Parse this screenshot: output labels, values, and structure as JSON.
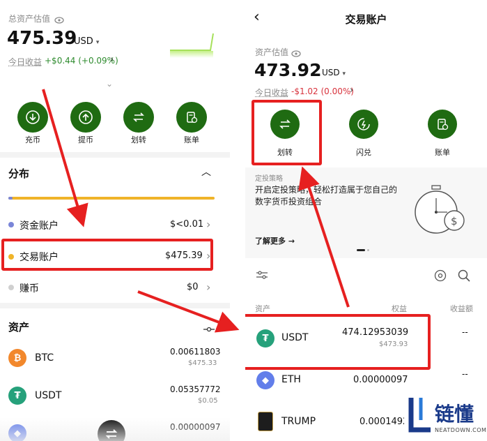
{
  "left": {
    "total_label": "总资产估值",
    "total_value": "475.39",
    "currency": "USD",
    "today_label": "今日收益",
    "today_value": "+$0.44 (+0.09%)",
    "actions": [
      {
        "label": "充币",
        "icon": "deposit-icon"
      },
      {
        "label": "提币",
        "icon": "withdraw-icon"
      },
      {
        "label": "划转",
        "icon": "transfer-icon"
      },
      {
        "label": "账单",
        "icon": "bill-icon"
      }
    ],
    "distribution_title": "分布",
    "accounts": [
      {
        "name": "资金账户",
        "value": "$<0.01",
        "color": "#7a86d8"
      },
      {
        "name": "交易账户",
        "value": "$475.39",
        "color": "#f0b429"
      },
      {
        "name": "赚币",
        "value": "$0",
        "color": "#d0d0d0"
      }
    ],
    "assets_title": "资产",
    "assets": [
      {
        "symbol": "BTC",
        "amount": "0.00611803",
        "usd": "$475.33",
        "color": "#f2882c"
      },
      {
        "symbol": "USDT",
        "amount": "0.05357772",
        "usd": "$0.05",
        "color": "#26a17b"
      },
      {
        "symbol": "ETH",
        "amount": "0.00000097",
        "usd": "",
        "color": "#627eea"
      }
    ]
  },
  "right": {
    "back_icon": "back-icon",
    "title": "交易账户",
    "valuation_label": "资产估值",
    "valuation_value": "473.92",
    "currency": "USD",
    "today_label": "今日收益",
    "today_value": "-$1.02 (0.00%)",
    "actions": [
      {
        "label": "划转",
        "icon": "transfer-icon"
      },
      {
        "label": "闪兑",
        "icon": "flash-swap-icon"
      },
      {
        "label": "账单",
        "icon": "bill-icon"
      }
    ],
    "promo_tag": "定投策略",
    "promo_text": "开启定投策略，轻松打造属于您自己的数字货币投资组合",
    "promo_link": "了解更多 →",
    "table_headers": {
      "asset": "资产",
      "equity": "权益",
      "pnl": "收益额"
    },
    "assets": [
      {
        "symbol": "USDT",
        "amount": "474.12953039",
        "usd": "$473.93",
        "pnl": "--",
        "color": "#26a17b"
      },
      {
        "symbol": "ETH",
        "amount": "0.00000097",
        "usd": "",
        "pnl": "--",
        "color": "#627eea"
      },
      {
        "symbol": "TRUMP",
        "amount": "0.0001492",
        "usd": "",
        "pnl": "",
        "color": "#1d1d1d"
      }
    ]
  },
  "watermark": {
    "brand": "链懂",
    "domain": "NEATDOWN.COM"
  },
  "colors": {
    "accent_green": "#1f6b12",
    "highlight_red": "#e62020",
    "gain": "#2e8b2e",
    "loss": "#d8323c"
  }
}
